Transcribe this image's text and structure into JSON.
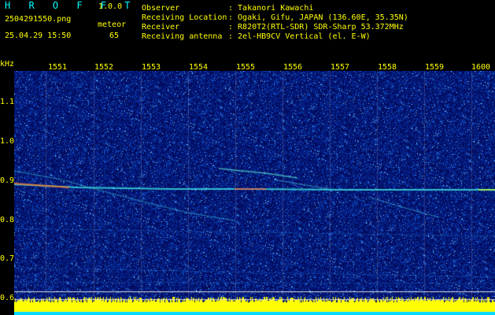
{
  "app": {
    "name": "H R O F F T",
    "version": "1.0.0"
  },
  "file": {
    "name": "2504291550.png",
    "datetime": "25.04.29 15:50"
  },
  "meteor": {
    "label": "meteor",
    "count": "65"
  },
  "info": {
    "observer_label": "Observer",
    "observer_value": ": Takanori Kawachi",
    "location_label": "Receiving Location",
    "location_value": ": Ogaki, Gifu, JAPAN (136.60E, 35.35N)",
    "receiver_label": "Receiver",
    "receiver_value": ": R820T2(RTL-SDR) SDR-Sharp 53.372MHz",
    "antenna_label": "Receiving antenna",
    "antenna_value": ": 2el-HB9CV Vertical (el. E-W)"
  },
  "axis": {
    "unit": "kHz",
    "time_ticks": [
      "1551",
      "1552",
      "1553",
      "1554",
      "1555",
      "1556",
      "1557",
      "1558",
      "1559",
      "1600"
    ],
    "freq_ticks": [
      "1.1",
      "1.0",
      "0.9",
      "0.8",
      "0.7",
      "0.6"
    ]
  },
  "colors": {
    "background": "#000000",
    "text_cyan": "#00ffff",
    "text_yellow": "#ffff00",
    "noise_blue": "#0a1e9a"
  }
}
